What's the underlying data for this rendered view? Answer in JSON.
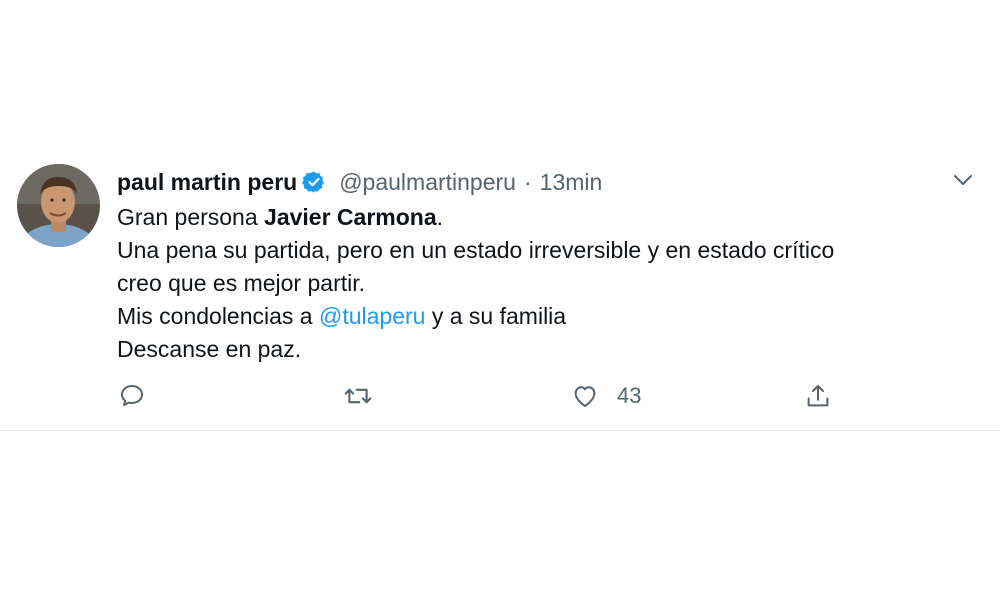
{
  "tweet": {
    "display_name": "paul martin peru",
    "handle": "@paulmartinperu",
    "separator": "·",
    "time": "13min",
    "body": {
      "line1_prefix": "Gran persona ",
      "line1_bold": "Javier Carmona",
      "line1_suffix": ".",
      "line2": "Una pena su partida, pero en un estado irreversible y en estado crítico",
      "line3": "creo que es mejor partir.",
      "line4_prefix": "Mis condolencias a ",
      "line4_mention": "@tulaperu",
      "line4_suffix": " y a su familia",
      "line5": "Descanse en paz."
    },
    "actions": {
      "like_count": "43"
    }
  },
  "colors": {
    "text": "#0f1419",
    "secondary": "#536471",
    "link": "#1d9bf0",
    "verified": "#1d9bf0",
    "divider": "#e6ecf0"
  },
  "icons": [
    "avatar",
    "verified-badge-icon",
    "chevron-down-icon",
    "reply-icon",
    "retweet-icon",
    "like-icon",
    "share-icon"
  ]
}
